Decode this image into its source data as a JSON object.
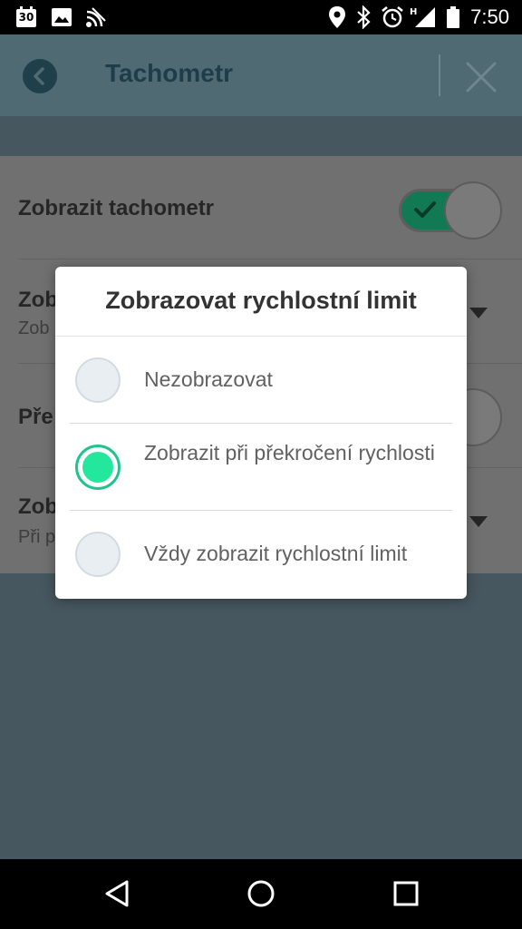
{
  "status_bar": {
    "calendar_day": "30",
    "time": "7:50",
    "icons": [
      "calendar-icon",
      "image-icon",
      "cast-icon",
      "location-icon",
      "bluetooth-icon",
      "alarm-icon",
      "signal-icon",
      "battery-icon"
    ]
  },
  "toolbar": {
    "title": "Tachometr",
    "back_icon": "back-icon",
    "close_icon": "close-icon"
  },
  "settings": [
    {
      "title": "Zobrazit tachometr",
      "subtitle": "",
      "control": "toggle",
      "value": true
    },
    {
      "title": "Zob",
      "subtitle": "Zob",
      "control": "dropdown"
    },
    {
      "title": "Pře",
      "subtitle": "",
      "control": "toggle",
      "value": false
    },
    {
      "title": "Zob",
      "subtitle": "Při p",
      "control": "dropdown"
    }
  ],
  "dialog": {
    "title": "Zobrazovat rychlostní limit",
    "options": [
      {
        "label": "Nezobrazovat",
        "selected": false
      },
      {
        "label": "Zobrazit při překročení rychlosti",
        "selected": true
      },
      {
        "label": "Vždy zobrazit rychlostní limit",
        "selected": false
      }
    ]
  },
  "nav_bar": {
    "icons": [
      "back-triangle-icon",
      "home-circle-icon",
      "recents-square-icon"
    ]
  },
  "colors": {
    "accent": "#23e79c",
    "toolbar_dimmed": "#4f6a72",
    "background_dimmed": "#47575f"
  }
}
